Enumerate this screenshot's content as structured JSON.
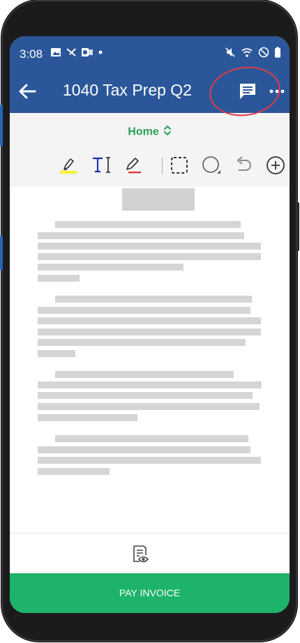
{
  "status_bar": {
    "time": "3:08",
    "left_icons": [
      "image-icon",
      "missed-call-icon",
      "outlook-icon",
      "dot-icon"
    ],
    "right_icons": [
      "mute-icon",
      "wifi-icon",
      "do-not-disturb-icon",
      "battery-icon"
    ]
  },
  "app_bar": {
    "title": "1040 Tax Prep Q2",
    "back_icon": "arrow-left-icon",
    "comment_icon": "comment-icon",
    "more_icon": "more-horizontal-icon"
  },
  "ribbon": {
    "tab_label": "Home",
    "tools": [
      "highlighter-icon",
      "text-box-icon",
      "pen-icon",
      "selection-icon",
      "shape-icon",
      "undo-icon",
      "add-icon"
    ]
  },
  "bottom_bar": {
    "reader_icon": "reader-view-icon",
    "pay_button_label": "PAY INVOICE"
  },
  "colors": {
    "app_bar": "#2b579a",
    "accent_green": "#2ca05a",
    "pay_button": "#1db36a",
    "annotation": "#e03a4a"
  }
}
